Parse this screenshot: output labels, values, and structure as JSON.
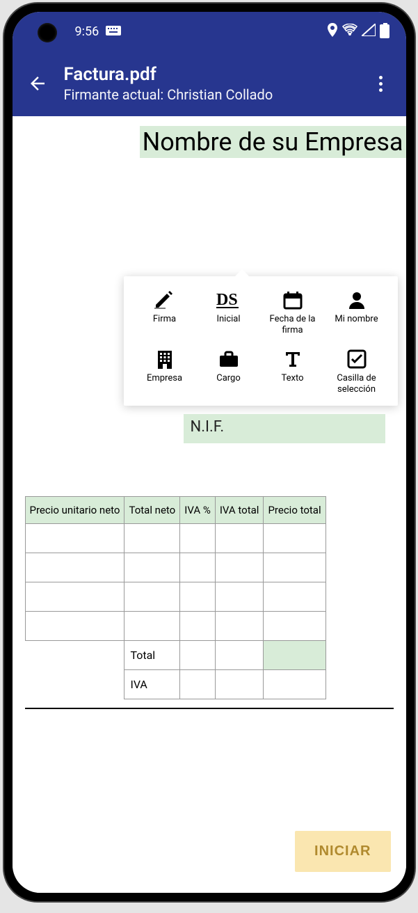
{
  "status": {
    "time": "9:56"
  },
  "appbar": {
    "title": "Factura.pdf",
    "subtitle": "Firmante actual: Christian Collado"
  },
  "heading": "Nombre de su Empresa",
  "tools": [
    {
      "label": "Firma"
    },
    {
      "label": "Inicial"
    },
    {
      "label": "Fecha de la firma"
    },
    {
      "label": "Mi nombre"
    },
    {
      "label": "Empresa"
    },
    {
      "label": "Cargo"
    },
    {
      "label": "Texto"
    },
    {
      "label": "Casilla de selección"
    }
  ],
  "nif_label": "N.I.F.",
  "table": {
    "headers": [
      "Precio unitario neto",
      "Total neto",
      "IVA %",
      "IVA total",
      "Precio total"
    ],
    "summary": {
      "total": "Total",
      "iva": "IVA"
    }
  },
  "start_button": "INICIAR"
}
